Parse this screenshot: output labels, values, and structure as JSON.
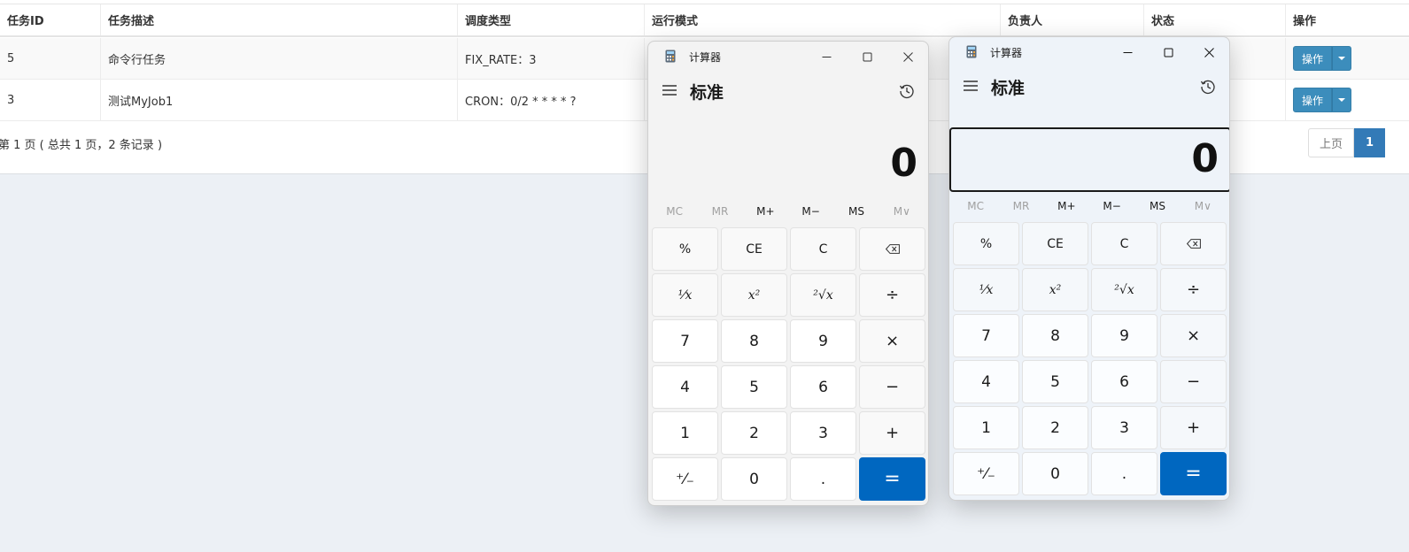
{
  "table": {
    "headers": {
      "id": "任务ID",
      "desc": "任务描述",
      "schedule": "调度类型",
      "mode": "运行模式",
      "owner": "负责人",
      "status": "状态",
      "ops": "操作"
    },
    "rows": [
      {
        "id": "5",
        "desc": "命令行任务",
        "schedule": "FIX_RATE：3",
        "op_label": "操作"
      },
      {
        "id": "3",
        "desc": "测试MyJob1",
        "schedule": "CRON：0/2 * * * * ?",
        "op_label": "操作"
      }
    ]
  },
  "pagination": {
    "info": "第 1 页 ( 总共 1 页，2 条记录 )",
    "prev_label": "上页",
    "current_page": "1"
  },
  "calculators": [
    {
      "title": "计算器",
      "mode": "标准",
      "display": "0",
      "memory": [
        "MC",
        "MR",
        "M+",
        "M−",
        "MS",
        "M∨"
      ],
      "keys": [
        "%",
        "CE",
        "C",
        "⌫",
        "¹⁄x",
        "x²",
        "²√x",
        "÷",
        "7",
        "8",
        "9",
        "×",
        "4",
        "5",
        "6",
        "−",
        "1",
        "2",
        "3",
        "+",
        "⁺⁄₋",
        "0",
        ".",
        "="
      ]
    },
    {
      "title": "计算器",
      "mode": "标准",
      "display": "0",
      "memory": [
        "MC",
        "MR",
        "M+",
        "M−",
        "MS",
        "M∨"
      ],
      "keys": [
        "%",
        "CE",
        "C",
        "⌫",
        "¹⁄x",
        "x²",
        "²√x",
        "÷",
        "7",
        "8",
        "9",
        "×",
        "4",
        "5",
        "6",
        "−",
        "1",
        "2",
        "3",
        "+",
        "⁺⁄₋",
        "0",
        ".",
        "="
      ]
    }
  ],
  "colors": {
    "accent_blue": "#0067c0",
    "button_blue": "#3c8dbc",
    "page_blue": "#337ab7"
  }
}
